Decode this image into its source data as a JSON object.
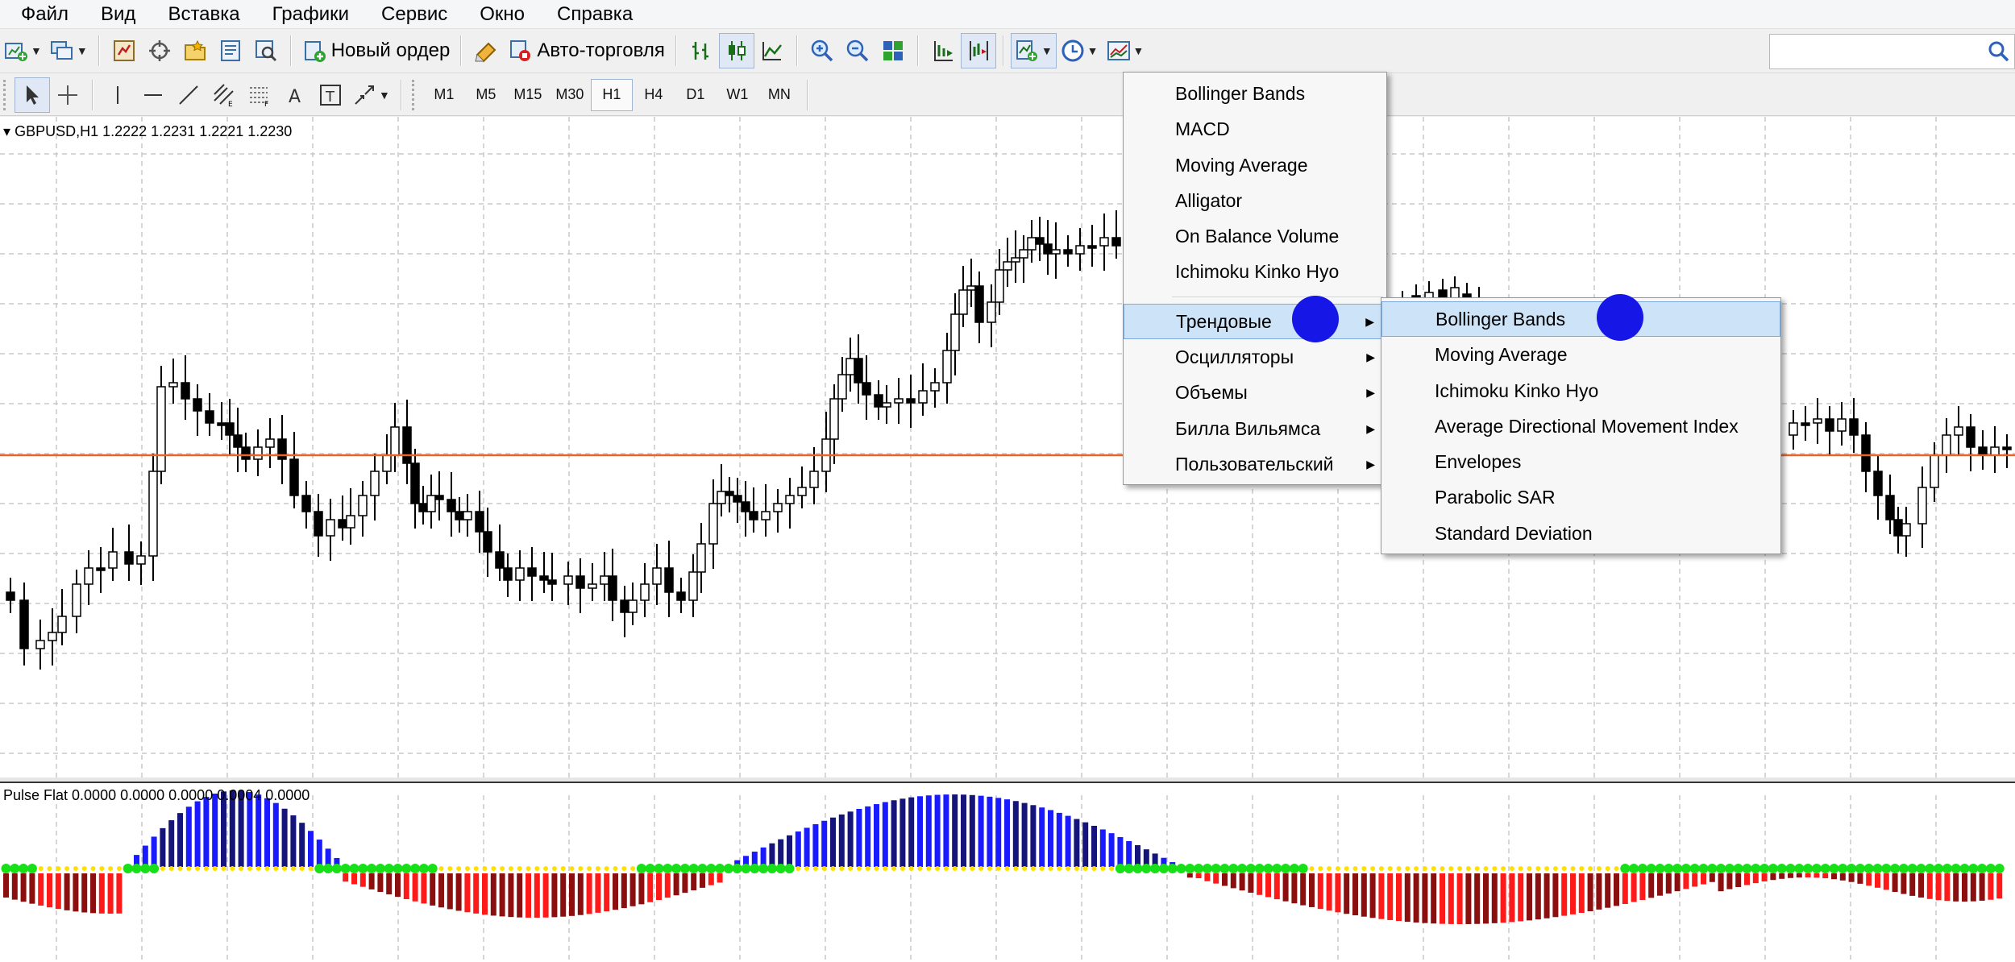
{
  "menubar": [
    "Файл",
    "Вид",
    "Вставка",
    "Графики",
    "Сервис",
    "Окно",
    "Справка"
  ],
  "toolbar": {
    "new_order": "Новый ордер",
    "auto_trading": "Авто-торговля"
  },
  "timeframes": [
    "M1",
    "M5",
    "M15",
    "M30",
    "H1",
    "H4",
    "D1",
    "W1",
    "MN"
  ],
  "selected_timeframe": "H1",
  "chart": {
    "symbol_label": "GBPUSD,H1  1.2222 1.2231 1.2221 1.2230",
    "indicator_label": "Pulse Flat 0.0000 0.0000 0.0000 0.0004 0.0000",
    "price_line_color": "#e8642a",
    "bull_color": "#000000",
    "bear_color": "#000000"
  },
  "indicator_colors": {
    "up_strong": "#1a1aff",
    "up_weak": "#14147a",
    "down_strong": "#ff1a1a",
    "down_weak": "#8b0f0f",
    "flat_dot": "#18e018",
    "zero_dot": "#ffe000"
  },
  "menu_main": {
    "recent": [
      "Bollinger Bands",
      "MACD",
      "Moving Average",
      "Alligator",
      "On Balance Volume",
      "Ichimoku Kinko Hyo"
    ],
    "groups": [
      "Трендовые",
      "Осцилляторы",
      "Объемы",
      "Билла Вильямса",
      "Пользовательский"
    ],
    "highlighted": "Трендовые"
  },
  "menu_trend": {
    "items": [
      "Bollinger Bands",
      "Moving Average",
      "Ichimoku Kinko Hyo",
      "Average Directional Movement Index",
      "Envelopes",
      "Parabolic SAR",
      "Standard Deviation"
    ],
    "highlighted": "Bollinger Bands"
  },
  "icons": [
    "new-chart-icon",
    "profiles-icon",
    "market-watch-icon",
    "data-window-icon",
    "navigator-icon",
    "terminal-icon",
    "strategy-tester-icon",
    "new-order-icon",
    "auto-trading-icon",
    "bar-chart-icon",
    "candles-icon",
    "line-chart-icon",
    "zoom-in-icon",
    "zoom-out-icon",
    "tile-windows-icon",
    "autoscroll-icon",
    "chart-shift-icon",
    "indicators-icon",
    "periods-icon",
    "templates-icon",
    "cursor-icon",
    "crosshair-icon",
    "vertical-line-icon",
    "horizontal-line-icon",
    "trendline-icon",
    "equidistant-channel-icon",
    "fibonacci-icon",
    "text-icon",
    "text-label-icon",
    "arrows-icon",
    "search-icon"
  ]
}
